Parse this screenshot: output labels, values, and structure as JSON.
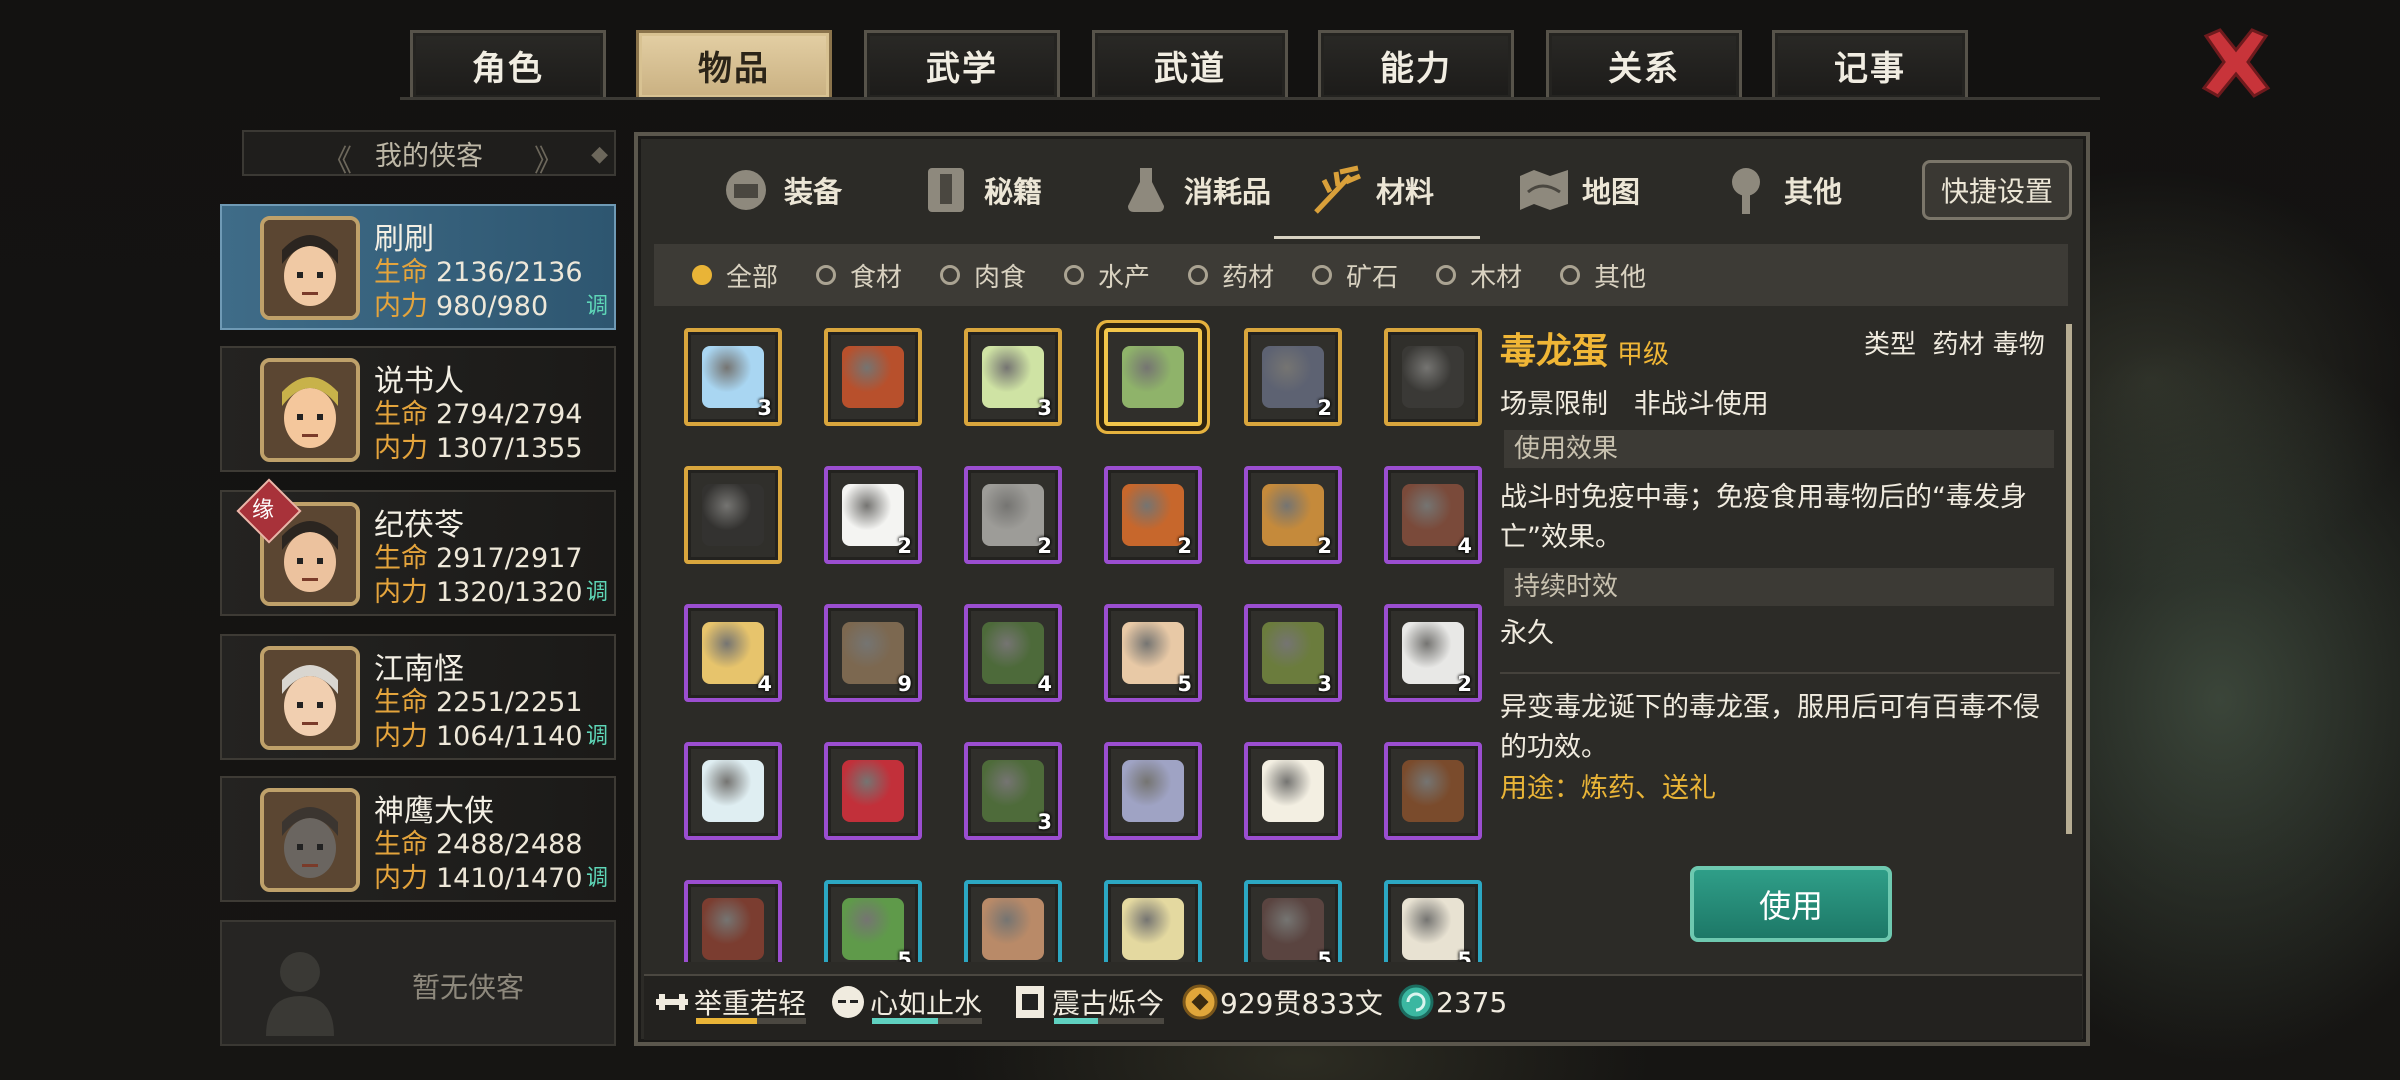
{
  "top_tabs": [
    "角色",
    "物品",
    "武学",
    "武道",
    "能力",
    "关系",
    "记事"
  ],
  "active_top_tab": 1,
  "left_panel": {
    "header": "我的侠客",
    "heroes": [
      {
        "name": "刷刷",
        "hp_label": "生命",
        "hp": "2136/2136",
        "mp_label": "内力",
        "mp": "980/980",
        "adjust": "调",
        "selected": true
      },
      {
        "name": "说书人",
        "hp_label": "生命",
        "hp": "2794/2794",
        "mp_label": "内力",
        "mp": "1307/1355",
        "adjust": ""
      },
      {
        "name": "纪茯苓",
        "hp_label": "生命",
        "hp": "2917/2917",
        "mp_label": "内力",
        "mp": "1320/1320",
        "adjust": "调",
        "badge": "缘"
      },
      {
        "name": "江南怪",
        "hp_label": "生命",
        "hp": "2251/2251",
        "mp_label": "内力",
        "mp": "1064/1140",
        "adjust": "调"
      },
      {
        "name": "神鹰大侠",
        "hp_label": "生命",
        "hp": "2488/2488",
        "mp_label": "内力",
        "mp": "1410/1470",
        "adjust": "调"
      }
    ],
    "empty_slot": "暂无侠客"
  },
  "sub_tabs": [
    {
      "label": "装备",
      "icon": "armor-icon"
    },
    {
      "label": "秘籍",
      "icon": "book-icon"
    },
    {
      "label": "消耗品",
      "icon": "potion-icon"
    },
    {
      "label": "材料",
      "icon": "herb-icon"
    },
    {
      "label": "地图",
      "icon": "map-icon"
    },
    {
      "label": "其他",
      "icon": "lamp-icon"
    }
  ],
  "active_sub_tab": 3,
  "quick_settings": "快捷设置",
  "filters": [
    "全部",
    "食材",
    "肉食",
    "水产",
    "药材",
    "矿石",
    "木材",
    "其他"
  ],
  "active_filter": 0,
  "items": [
    {
      "icon": "ice-cube-icon",
      "rarity": "gold",
      "count": "3",
      "color": "#a9d6f2"
    },
    {
      "icon": "mushroom-icon",
      "rarity": "gold",
      "count": "",
      "color": "#b8502c"
    },
    {
      "icon": "cabbage-icon",
      "rarity": "gold",
      "count": "3",
      "color": "#cfe3a4"
    },
    {
      "icon": "poison-dragon-egg-icon",
      "rarity": "gold",
      "count": "",
      "color": "#8fb36a",
      "selected": true
    },
    {
      "icon": "iron-ingot-icon",
      "rarity": "gold",
      "count": "2",
      "color": "#5d6272"
    },
    {
      "icon": "dark-log-icon",
      "rarity": "gold",
      "count": "",
      "color": "#3a3936"
    },
    {
      "icon": "charcoal-icon",
      "rarity": "gold",
      "count": "",
      "color": "#333230"
    },
    {
      "icon": "salt-icon",
      "rarity": "purple",
      "count": "2",
      "color": "#f4f4f2"
    },
    {
      "icon": "powder-icon",
      "rarity": "purple",
      "count": "2",
      "color": "#9d9c98"
    },
    {
      "icon": "meat-dish-icon",
      "rarity": "purple",
      "count": "2",
      "color": "#c7672c"
    },
    {
      "icon": "dried-meat-icon",
      "rarity": "purple",
      "count": "2",
      "color": "#c58a3b"
    },
    {
      "icon": "ore-chunk-icon",
      "rarity": "purple",
      "count": "4",
      "color": "#7a4a3a"
    },
    {
      "icon": "gold-nugget-icon",
      "rarity": "purple",
      "count": "4",
      "color": "#e7c46c"
    },
    {
      "icon": "bark-icon",
      "rarity": "purple",
      "count": "9",
      "color": "#7c6850"
    },
    {
      "icon": "leaves-icon",
      "rarity": "purple",
      "count": "4",
      "color": "#4d6a3a"
    },
    {
      "icon": "lotus-icon",
      "rarity": "purple",
      "count": "5",
      "color": "#e8c9a6"
    },
    {
      "icon": "herb-bundle-icon",
      "rarity": "purple",
      "count": "3",
      "color": "#6b7c3d"
    },
    {
      "icon": "pearls-icon",
      "rarity": "purple",
      "count": "2",
      "color": "#e8e8e6"
    },
    {
      "icon": "white-flower-icon",
      "rarity": "purple",
      "count": "",
      "color": "#dfeef2"
    },
    {
      "icon": "red-flower-icon",
      "rarity": "purple",
      "count": "",
      "color": "#c2303a"
    },
    {
      "icon": "mint-leaf-icon",
      "rarity": "purple",
      "count": "3",
      "color": "#4e6b3a"
    },
    {
      "icon": "crystal-ore-icon",
      "rarity": "purple",
      "count": "",
      "color": "#9fa3c4"
    },
    {
      "icon": "white-egg-icon",
      "rarity": "purple",
      "count": "",
      "color": "#f3efe2"
    },
    {
      "icon": "wood-log-icon",
      "rarity": "purple",
      "count": "",
      "color": "#7a4b2c"
    },
    {
      "icon": "red-log-icon",
      "rarity": "purple",
      "count": "",
      "color": "#7b3d30"
    },
    {
      "icon": "vegetable-icon",
      "rarity": "cyan",
      "count": "5",
      "color": "#5f9a4a"
    },
    {
      "icon": "garlic-icon",
      "rarity": "cyan",
      "count": "",
      "color": "#b98a68"
    },
    {
      "icon": "bamboo-shoot-icon",
      "rarity": "cyan",
      "count": "",
      "color": "#e4d9a0"
    },
    {
      "icon": "dark-ore-icon",
      "rarity": "cyan",
      "count": "5",
      "color": "#5a4440"
    },
    {
      "icon": "mushroom-cluster-icon",
      "rarity": "cyan",
      "count": "5",
      "color": "#e8e2d2"
    }
  ],
  "detail": {
    "name": "毒龙蛋",
    "grade": "甲级",
    "type_label": "类型",
    "type_value": "药材 毒物",
    "scene_label": "场景限制",
    "scene_value": "非战斗使用",
    "effect_header": "使用效果",
    "effect_text": "战斗时免疫中毒；免疫食用毒物后的“毒发身亡”效果。",
    "duration_header": "持续时效",
    "duration_text": "永久",
    "description": "异变毒龙诞下的毒龙蛋，服用后可有百毒不侵的功效。",
    "usage": "用途：炼药、送礼",
    "use_button": "使用"
  },
  "bottom": {
    "skills": [
      {
        "name": "举重若轻",
        "icon": "strength-icon",
        "progress": 0.55,
        "color": "#e9b437"
      },
      {
        "name": "心如止水",
        "icon": "calm-face-icon",
        "progress": 0.6,
        "color": "#5fd1c0"
      },
      {
        "name": "震古烁今",
        "icon": "banner-icon",
        "progress": 0.4,
        "color": "#5fd1c0"
      }
    ],
    "money": "929贯833文",
    "jade": "2375"
  }
}
